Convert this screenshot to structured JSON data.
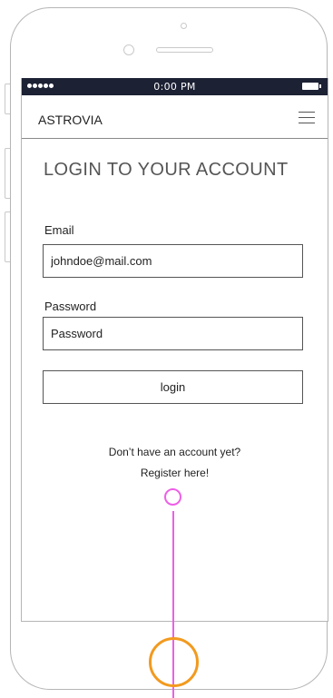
{
  "status_bar": {
    "time": "0:00 PM"
  },
  "navbar": {
    "brand": "ASTROVIA",
    "menu_icon": "hamburger-menu-icon"
  },
  "login": {
    "title": "LOGIN TO YOUR ACCOUNT",
    "email_label": "Email",
    "email_value": "johndoe@mail.com",
    "password_label": "Password",
    "password_placeholder": "Password",
    "login_button": "login",
    "register_prompt": "Don’t have an account yet?",
    "register_link": "Register here!"
  },
  "colors": {
    "status_bar": "#1c2134",
    "flow_connector": "#ee5fe6",
    "home_button": "#f29a1f"
  }
}
